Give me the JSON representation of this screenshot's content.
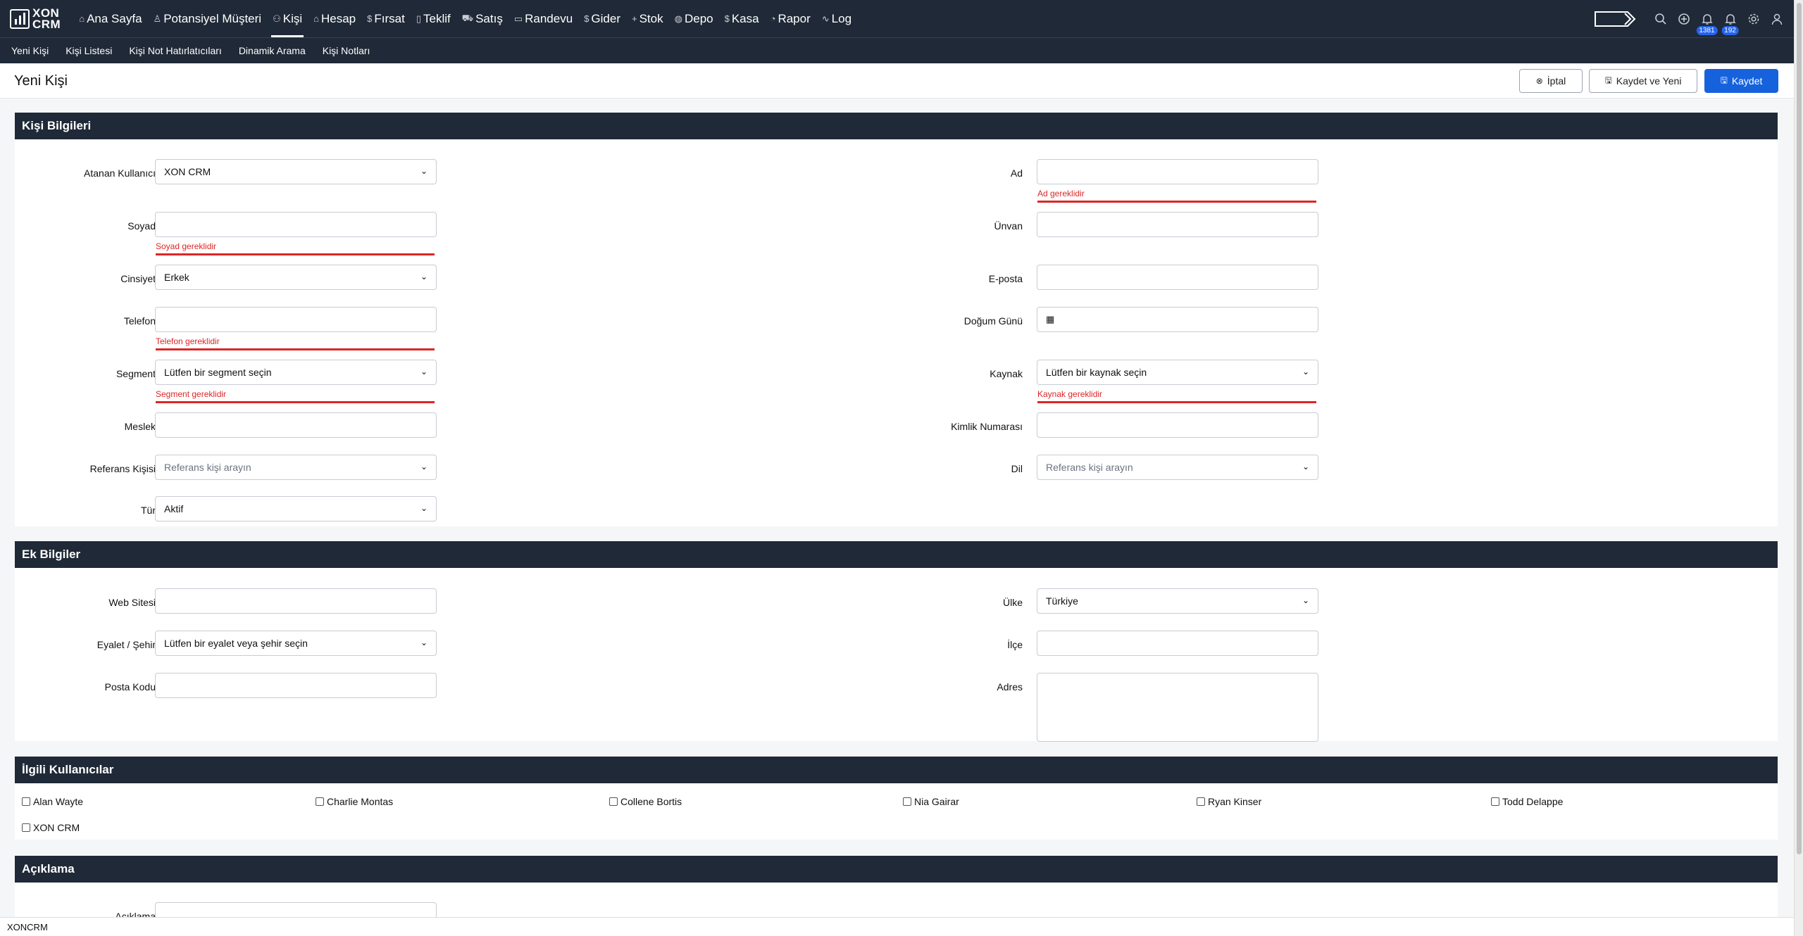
{
  "app": {
    "logo_text_1": "XON",
    "logo_text_2": "CRM"
  },
  "nav": {
    "items": [
      {
        "label": "Ana Sayfa",
        "icon": "⌂",
        "icon_name": "home-icon"
      },
      {
        "label": "Potansiyel Müşteri",
        "icon": "♙",
        "icon_name": "user-icon"
      },
      {
        "label": "Kişi",
        "icon": "⚇",
        "icon_name": "users-icon",
        "active": true
      },
      {
        "label": "Hesap",
        "icon": "⌂",
        "icon_name": "building-icon"
      },
      {
        "label": "Fırsat",
        "icon": "$",
        "icon_name": "dollar-icon"
      },
      {
        "label": "Teklif",
        "icon": "▯",
        "icon_name": "document-icon"
      },
      {
        "label": "Satış",
        "icon": "⛟",
        "icon_name": "cart-icon"
      },
      {
        "label": "Randevu",
        "icon": "▭",
        "icon_name": "calendar-icon"
      },
      {
        "label": "Gider",
        "icon": "$",
        "icon_name": "dollar-icon"
      },
      {
        "label": "Stok",
        "icon": "+",
        "icon_name": "plus-icon"
      },
      {
        "label": "Depo",
        "icon": "◍",
        "icon_name": "warehouse-icon"
      },
      {
        "label": "Kasa",
        "icon": "$",
        "icon_name": "dollar-icon"
      },
      {
        "label": "Rapor",
        "icon": "◔",
        "icon_name": "chart-icon"
      },
      {
        "label": "Log",
        "icon": "∿",
        "icon_name": "activity-icon"
      }
    ],
    "badges": {
      "notifications_1": "1381",
      "notifications_2": "192"
    }
  },
  "subnav": {
    "items": [
      "Yeni Kişi",
      "Kişi Listesi",
      "Kişi Not Hatırlatıcıları",
      "Dinamik Arama",
      "Kişi Notları"
    ]
  },
  "header": {
    "title": "Yeni Kişi",
    "cancel_label": "İptal",
    "save_new_label": "Kaydet ve Yeni",
    "save_label": "Kaydet"
  },
  "sections": {
    "kisi_bilgileri": "Kişi Bilgileri",
    "ek_bilgiler": "Ek Bilgiler",
    "ilgili_kullanicilar": "İlgili Kullanıcılar",
    "aciklama": "Açıklama"
  },
  "form": {
    "atanan_kullanici": {
      "label": "Atanan Kullanıcı",
      "value": "XON CRM"
    },
    "ad": {
      "label": "Ad",
      "value": "",
      "error": "Ad gereklidir"
    },
    "soyad": {
      "label": "Soyad",
      "value": "",
      "error": "Soyad gereklidir"
    },
    "unvan": {
      "label": "Ünvan",
      "value": ""
    },
    "cinsiyet": {
      "label": "Cinsiyet",
      "value": "Erkek"
    },
    "eposta": {
      "label": "E-posta",
      "value": ""
    },
    "telefon": {
      "label": "Telefon",
      "value": "",
      "error": "Telefon gereklidir"
    },
    "dogum_gunu": {
      "label": "Doğum Günü",
      "value": ""
    },
    "segment": {
      "label": "Segment",
      "placeholder": "Lütfen bir segment seçin",
      "error": "Segment gereklidir"
    },
    "kaynak": {
      "label": "Kaynak",
      "placeholder": "Lütfen bir kaynak seçin",
      "error": "Kaynak gereklidir"
    },
    "meslek": {
      "label": "Meslek",
      "value": ""
    },
    "kimlik_numarasi": {
      "label": "Kimlik Numarası",
      "value": ""
    },
    "referans_kisisi": {
      "label": "Referans Kişisi",
      "placeholder": "Referans kişi arayın"
    },
    "dil": {
      "label": "Dil",
      "placeholder": "Referans kişi arayın"
    },
    "tur": {
      "label": "Tür",
      "value": "Aktif"
    },
    "web_sitesi": {
      "label": "Web Sitesi",
      "value": ""
    },
    "ulke": {
      "label": "Ülke",
      "value": "Türkiye"
    },
    "eyalet_sehir": {
      "label": "Eyalet / Şehir",
      "value": "Lütfen bir eyalet veya şehir seçin"
    },
    "ilce": {
      "label": "İlçe",
      "value": ""
    },
    "posta_kodu": {
      "label": "Posta Kodu",
      "value": ""
    },
    "adres": {
      "label": "Adres",
      "value": ""
    },
    "aciklama": {
      "label": "Açıklama"
    }
  },
  "related_users": [
    "Alan Wayte",
    "Charlie Montas",
    "Collene Bortis",
    "Nia Gairar",
    "Ryan Kinser",
    "Todd Delappe",
    "XON CRM"
  ],
  "footer": {
    "text": "XONCRM"
  }
}
